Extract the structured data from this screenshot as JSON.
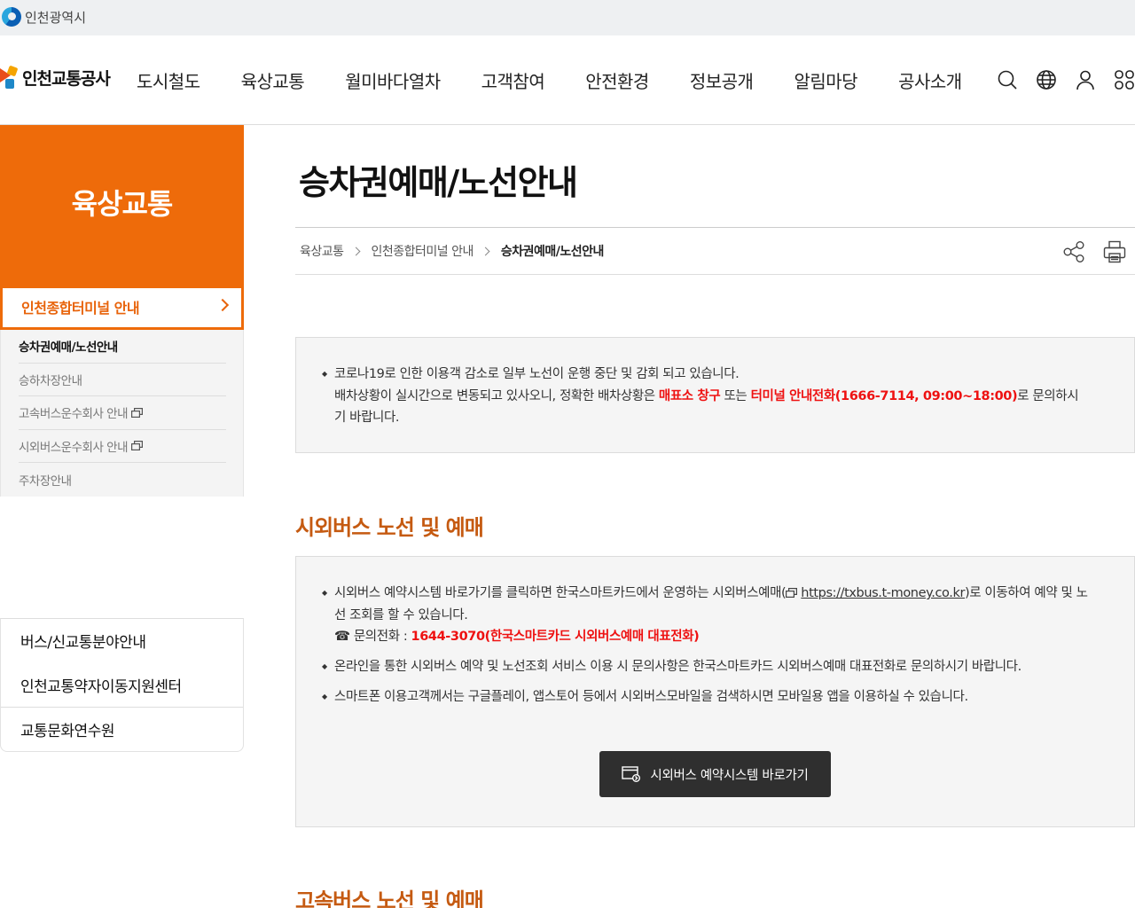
{
  "gov": {
    "name": "인천광역시"
  },
  "header": {
    "brand": "인천교통공사",
    "nav": [
      "도시철도",
      "육상교통",
      "월미바다열차",
      "고객참여",
      "안전환경",
      "정보공개",
      "알림마당",
      "공사소개"
    ],
    "icons": [
      "search-icon",
      "globe-icon",
      "user-icon",
      "sitemap-icon"
    ]
  },
  "sidebar": {
    "heading": "육상교통",
    "active": "인천종합터미널 안내",
    "sub_items": [
      "승차권예매/노선안내",
      "승하차장안내",
      "고속버스운수회사 안내",
      "시외버스운수회사 안내",
      "주차장안내"
    ],
    "links": [
      "버스/신교통분야안내",
      "인천교통약자이동지원센터",
      "교통문화연수원"
    ]
  },
  "main": {
    "title": "승차권예매/노선안내",
    "breadcrumb": [
      "육상교통",
      "인천종합터미널 안내",
      "승차권예매/노선안내"
    ],
    "notice": {
      "line1": "코로나19로 인한 이용객 감소로 일부 노선이 운행 중단 및 감회 되고 있습니다.",
      "line2_pre": "배차상황이 실시간으로 변동되고 있사오니, 정확한 배차상황은 ",
      "line2_red1": "매표소 창구",
      "line2_mid": " 또는 ",
      "line2_red2": "터미널 안내전화(1666-7114, 09:00~18:00)",
      "line2_post": "로 문의하시기 바랍니다."
    },
    "section1": {
      "heading": "시외버스 노선 및 예매",
      "b1_pre": "시외버스 예약시스템 바로가기를 클릭하면 한국스마트카드에서 운영하는 시외버스예매(",
      "b1_link": "https://txbus.t-money.co.kr",
      "b1_post": ")로 이동하여 예약 및 노선 조회를 할 수 있습니다.",
      "phone_label": "☎ 문의전화 : ",
      "phone_value": "1644-3070(한국스마트카드 시외버스예매 대표전화)",
      "b2": "온라인을 통한 시외버스 예약 및 노선조회 서비스 이용 시 문의사항은 한국스마트카드 시외버스예매 대표전화로 문의하시기 바랍니다.",
      "b3": "스마트폰 이용고객께서는 구글플레이, 앱스토어 등에서 시외버스모바일을 검색하시면 모바일용 앱을 이용하실 수 있습니다.",
      "button": "시외버스 예약시스템 바로가기"
    },
    "section2": {
      "heading": "고속버스 노선 및 예매"
    }
  },
  "colors": {
    "accent": "#ee6b0a",
    "heading": "#c55a11",
    "alert": "#e11111"
  }
}
